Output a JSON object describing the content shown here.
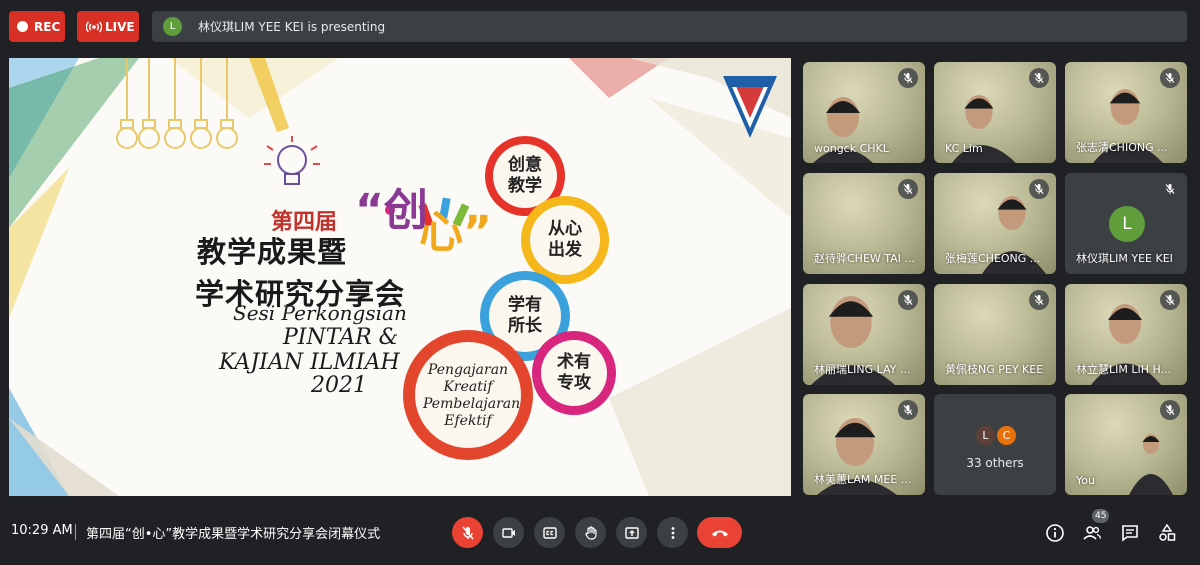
{
  "topbar": {
    "rec_label": "REC",
    "live_label": "LIVE",
    "presenter_initial": "L",
    "presenting_text": "林仪琪LIM YEE KEI is presenting"
  },
  "slide": {
    "disiwei": "第四届",
    "chuang": "“创",
    "xin": "心”",
    "title_line1": "教学成果暨",
    "title_line2": "学术研究分享会",
    "sesi": "Sesi Perkongsian",
    "pintar": "PINTAR &",
    "kajian": "KAJIAN ILMIAH",
    "year": "2021",
    "circle1": "创意\n教学",
    "circle2": "从心\n出发",
    "circle3": "学有\n所长",
    "circle4": "术有\n专攻",
    "circle5": "Pengajaran\nKreatif\nPembelajaran\nEfektif"
  },
  "tiles": [
    {
      "name": "wongck CHKL"
    },
    {
      "name": "KC Lim"
    },
    {
      "name": "张志清CHIONG ..."
    },
    {
      "name": "赵待骅CHEW TAI ..."
    },
    {
      "name": "张梅莲CHEONG ..."
    },
    {
      "name": "林仪琪LIM YEE KEI",
      "initial": "L"
    },
    {
      "name": "林丽瑞LING LAY ..."
    },
    {
      "name": "黄佩枝NG PEY KEE"
    },
    {
      "name": "林立慧LIM LIH H..."
    },
    {
      "name": "林美蕙LAM MEE ..."
    },
    {
      "name": "33 others",
      "initials": [
        "L",
        "C"
      ]
    },
    {
      "name": "You"
    }
  ],
  "bottombar": {
    "time": "10:29 AM",
    "meeting_title": "第四届“创•心”教学成果暨学术研究分享会闭幕仪式",
    "participants_count": "45"
  },
  "colors": {
    "rec_red": "#d93025",
    "background": "#202124",
    "tile_bg": "#3c4043",
    "end_call": "#ea4335"
  }
}
